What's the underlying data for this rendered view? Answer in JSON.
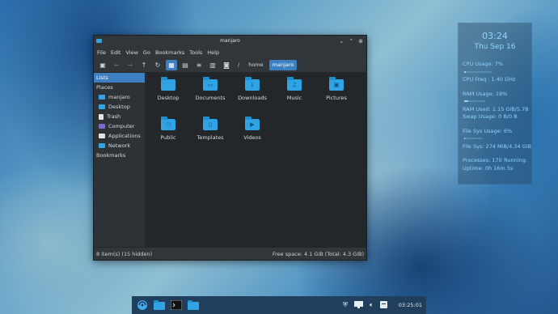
{
  "window": {
    "title": "manjaro",
    "buttons": {
      "minimize": "⌄",
      "maximize": "⌃",
      "close": "⊗"
    },
    "menu": [
      "File",
      "Edit",
      "View",
      "Go",
      "Bookmarks",
      "Tools",
      "Help"
    ],
    "breadcrumb": [
      "/",
      "home",
      "manjaro"
    ],
    "sidebar": {
      "lists": "Lists",
      "places_header": "Places",
      "places": [
        {
          "label": "manjaro",
          "icon": "home-folder-icon",
          "color": "#2fa3e3"
        },
        {
          "label": "Desktop",
          "icon": "desktop-folder-icon",
          "color": "#2fa3e3"
        },
        {
          "label": "Trash",
          "icon": "trash-icon",
          "color": "#e4e4e4"
        },
        {
          "label": "Computer",
          "icon": "computer-icon",
          "color": "#7f66c9"
        },
        {
          "label": "Applications",
          "icon": "applications-icon",
          "color": "#e4e4e4"
        },
        {
          "label": "Network",
          "icon": "network-icon",
          "color": "#2fa3e3"
        }
      ],
      "bookmarks_header": "Bookmarks"
    },
    "files": [
      {
        "label": "Desktop",
        "glyph": ""
      },
      {
        "label": "Documents",
        "glyph": "▭"
      },
      {
        "label": "Downloads",
        "glyph": "↓"
      },
      {
        "label": "Music",
        "glyph": "♫"
      },
      {
        "label": "Pictures",
        "glyph": "▣"
      },
      {
        "label": "Public",
        "glyph": "⚇"
      },
      {
        "label": "Templates",
        "glyph": "▯"
      },
      {
        "label": "Videos",
        "glyph": "▶"
      }
    ],
    "status_left": "8 item(s) (15 hidden)",
    "status_right": "Free space: 4.1 GiB (Total: 4.3 GiB)"
  },
  "conky": {
    "time": "03:24",
    "date": "Thu Sep 16",
    "cpu_usage": "CPU Usage: 7%",
    "cpu_usage_level": 0.07,
    "cpu_freq": "CPU Freq : 1.40 GHz",
    "ram_usage": "RAM Usage: 19%",
    "ram_usage_level": 0.19,
    "ram_used": "RAM Used: 1.15 GiB/5.78",
    "swap_usage": "Swap Usage: 0 B/0 B",
    "fs_usage": "File Sys Usage: 6%",
    "fs_usage_level": 0.06,
    "fs_sys": "File Sys: 274 MiB/4.34 GiB",
    "processes": "Processes: 170",
    "running": "Running:",
    "uptime": "Uptime: 0h 16m 5s"
  },
  "taskbar": {
    "clock": "03:25:01"
  },
  "colors": {
    "accent": "#3d7fbf",
    "folder": "#2fa3e3",
    "conky_text": "#8fd3ff"
  }
}
